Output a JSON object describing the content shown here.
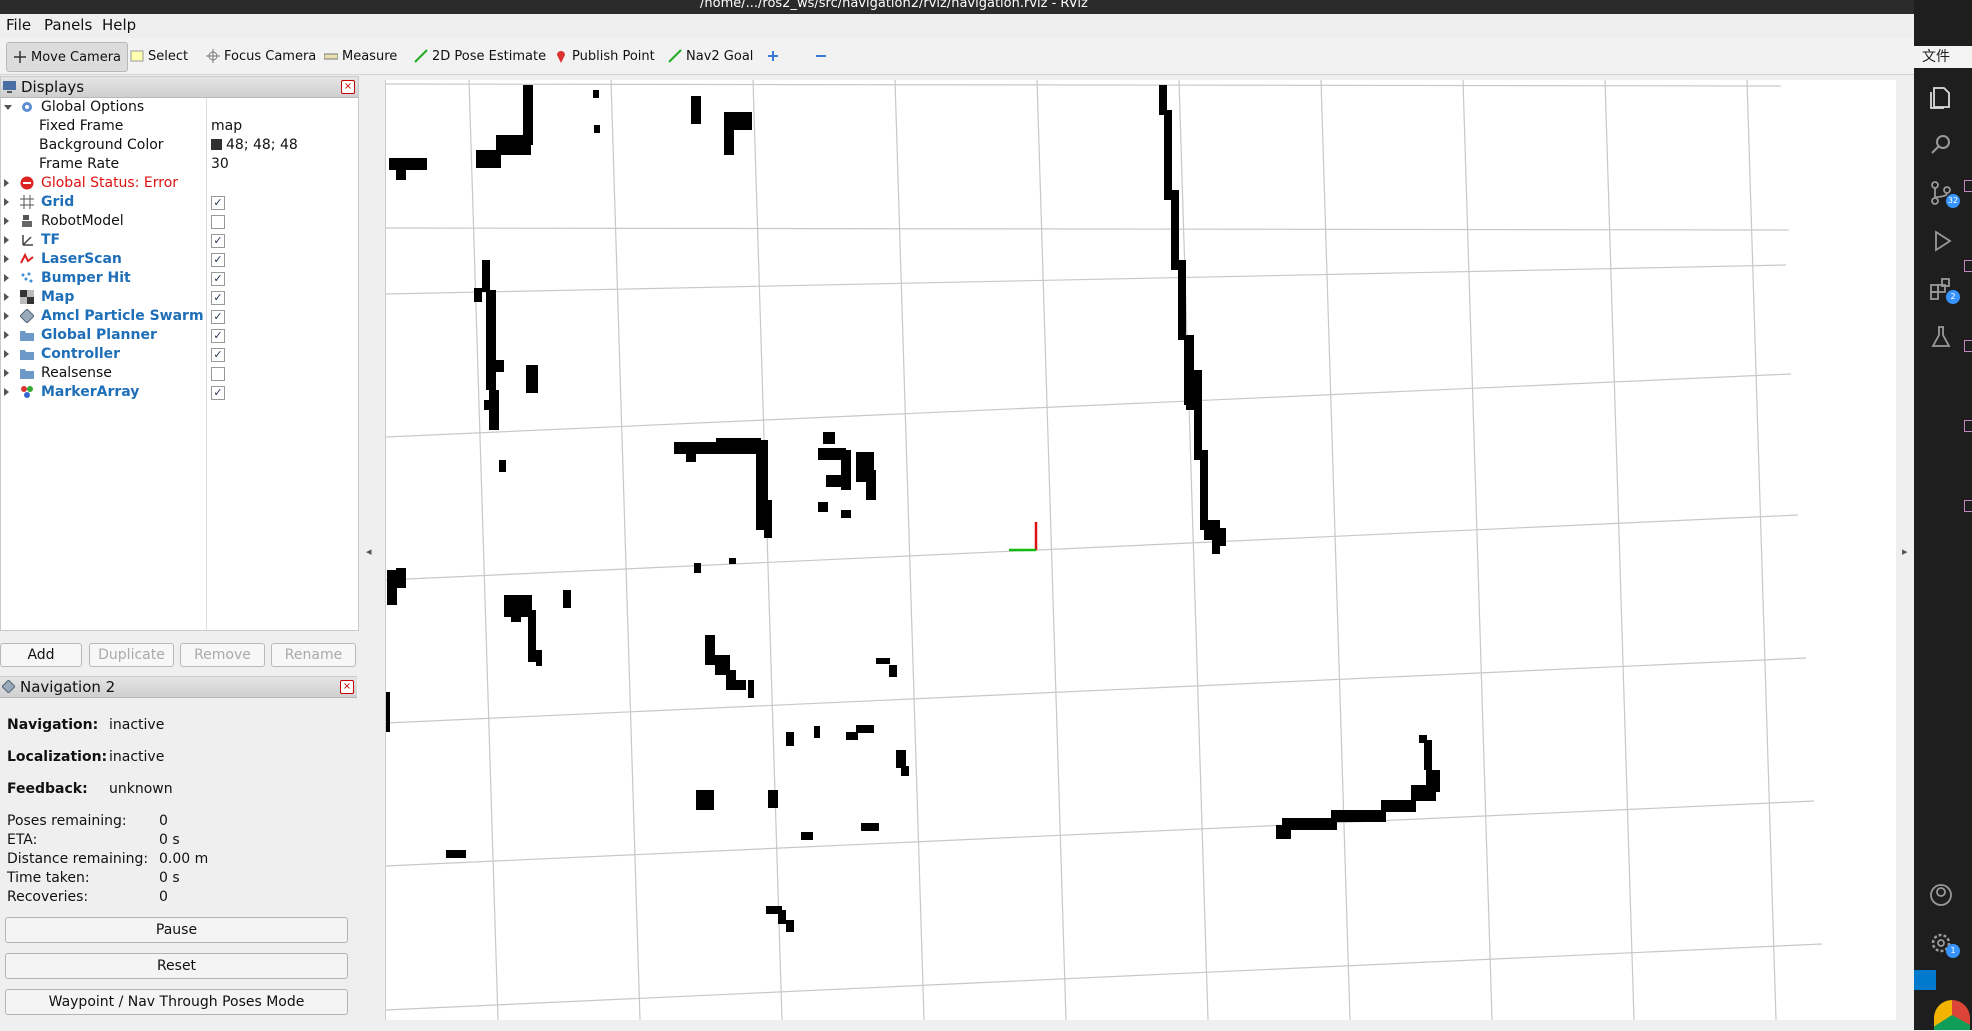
{
  "window": {
    "title": "/home/.../ros2_ws/src/navigation2/rviz/navigation.rviz - RViz"
  },
  "menu": [
    "File",
    "Panels",
    "Help"
  ],
  "toolbar": {
    "tools": [
      {
        "label": "Move Camera",
        "icon": "move-camera-icon",
        "active": true
      },
      {
        "label": "Select",
        "icon": "select-icon"
      },
      {
        "label": "Focus Camera",
        "icon": "focus-camera-icon"
      },
      {
        "label": "Measure",
        "icon": "measure-icon"
      },
      {
        "label": "2D Pose Estimate",
        "icon": "pose-estimate-icon"
      },
      {
        "label": "Publish Point",
        "icon": "publish-point-icon"
      },
      {
        "label": "Nav2 Goal",
        "icon": "nav2-goal-icon"
      }
    ]
  },
  "displays": {
    "title": "Displays",
    "global_options": {
      "label": "Global Options",
      "fixed_frame": {
        "label": "Fixed Frame",
        "value": "map"
      },
      "background_color": {
        "label": "Background Color",
        "value": "48; 48; 48"
      },
      "frame_rate": {
        "label": "Frame Rate",
        "value": "30"
      }
    },
    "global_status": "Global Status: Error",
    "items": [
      {
        "label": "Grid",
        "checked": true,
        "blue": true
      },
      {
        "label": "RobotModel",
        "checked": false,
        "blue": false
      },
      {
        "label": "TF",
        "checked": true,
        "blue": true
      },
      {
        "label": "LaserScan",
        "checked": true,
        "blue": true
      },
      {
        "label": "Bumper Hit",
        "checked": true,
        "blue": true
      },
      {
        "label": "Map",
        "checked": true,
        "blue": true
      },
      {
        "label": "Amcl Particle Swarm",
        "checked": true,
        "blue": true
      },
      {
        "label": "Global Planner",
        "checked": true,
        "blue": true
      },
      {
        "label": "Controller",
        "checked": true,
        "blue": true
      },
      {
        "label": "Realsense",
        "checked": false,
        "blue": false
      },
      {
        "label": "MarkerArray",
        "checked": true,
        "blue": true
      }
    ],
    "buttons": {
      "add": "Add",
      "duplicate": "Duplicate",
      "remove": "Remove",
      "rename": "Rename"
    }
  },
  "nav2": {
    "title": "Navigation 2",
    "navigation": {
      "label": "Navigation:",
      "value": "inactive"
    },
    "localization": {
      "label": "Localization:",
      "value": "inactive"
    },
    "feedback": {
      "label": "Feedback:",
      "value": "unknown"
    },
    "poses_remaining": {
      "label": "Poses remaining:",
      "value": "0"
    },
    "eta": {
      "label": "ETA:",
      "value": "0 s"
    },
    "distance_remaining": {
      "label": "Distance remaining:",
      "value": "0.00 m"
    },
    "time_taken": {
      "label": "Time taken:",
      "value": "0 s"
    },
    "recoveries": {
      "label": "Recoveries:",
      "value": "0"
    },
    "pause": "Pause",
    "reset": "Reset",
    "waypoint_mode": "Waypoint / Nav Through Poses Mode"
  },
  "vscode": {
    "tab_label": "文件",
    "badges": [
      "32",
      "2",
      "1"
    ]
  }
}
